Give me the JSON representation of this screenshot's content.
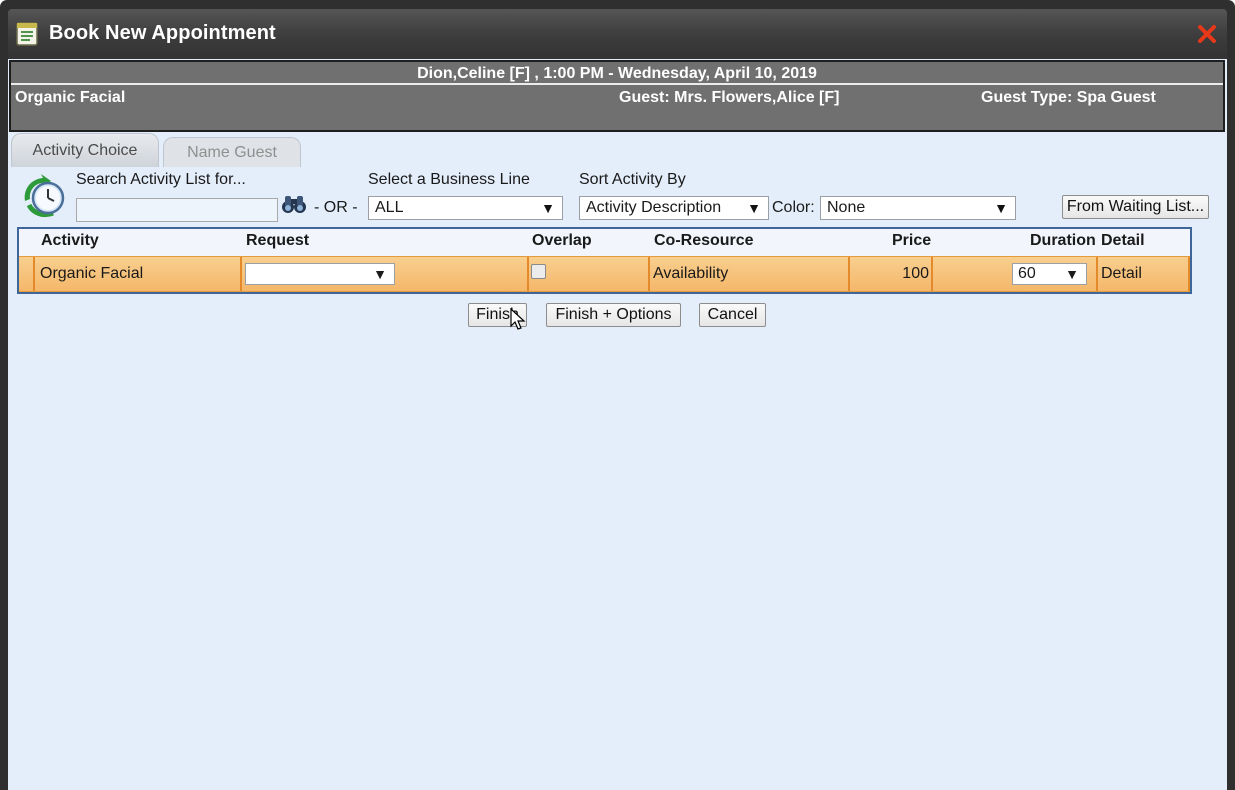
{
  "window": {
    "title": "Book New Appointment"
  },
  "info": {
    "header_line": "Dion,Celine [F] , 1:00 PM - Wednesday, April 10, 2019",
    "activity": "Organic Facial",
    "guest": "Guest: Mrs. Flowers,Alice [F]",
    "guest_type": "Guest Type: Spa Guest"
  },
  "tabs": [
    {
      "label": "Activity Choice",
      "active": true
    },
    {
      "label": "Name Guest",
      "active": false
    }
  ],
  "search": {
    "label": "Search Activity List for...",
    "value": "",
    "or_label": "- OR -"
  },
  "business_line": {
    "label": "Select a Business Line",
    "selected": "ALL"
  },
  "sort": {
    "label": "Sort Activity By",
    "selected": "Activity Description"
  },
  "color": {
    "label": "Color:",
    "selected": "None"
  },
  "waiting_list_button": "From Waiting List...",
  "table": {
    "columns": [
      "Activity",
      "Request",
      "Overlap",
      "Co-Resource",
      "Price",
      "Duration",
      "Detail"
    ],
    "rows": [
      {
        "activity": "Organic Facial",
        "request": "",
        "overlap": false,
        "co_resource": "Availability",
        "price": "100",
        "duration": "60",
        "detail": "Detail"
      }
    ]
  },
  "actions": {
    "finish": "Finish",
    "finish_options": "Finish + Options",
    "cancel": "Cancel"
  },
  "colors": {
    "title_bar": "#3c3c3c",
    "panel_bg": "#e4eefb",
    "row_highlight": "#f5b76a",
    "close": "#e8381a"
  }
}
